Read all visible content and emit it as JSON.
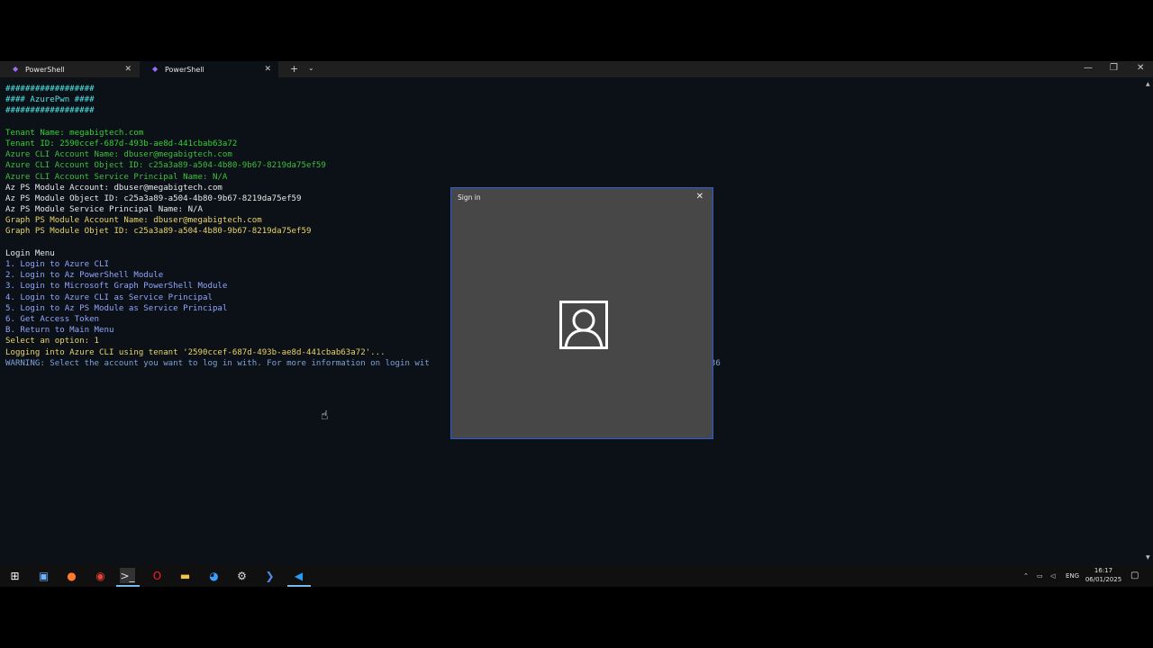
{
  "window": {
    "tabs": [
      {
        "label": "PowerShell"
      },
      {
        "label": "PowerShell"
      }
    ]
  },
  "terminal": {
    "lines": [
      {
        "text": "##################",
        "color": "cyan"
      },
      {
        "text": "#### AzurePwn ####",
        "color": "cyan"
      },
      {
        "text": "##################",
        "color": "cyan"
      },
      {
        "text": "",
        "color": "white"
      },
      {
        "text": "Tenant Name: megabigtech.com",
        "color": "green"
      },
      {
        "text": "Tenant ID: 2590ccef-687d-493b-ae8d-441cbab63a72",
        "color": "green"
      },
      {
        "text": "Azure CLI Account Name: dbuser@megabigtech.com",
        "color": "green2"
      },
      {
        "text": "Azure CLI Account Object ID: c25a3a89-a504-4b80-9b67-8219da75ef59",
        "color": "green2"
      },
      {
        "text": "Azure CLI Account Service Principal Name: N/A",
        "color": "green2"
      },
      {
        "text": "Az PS Module Account: dbuser@megabigtech.com",
        "color": "white"
      },
      {
        "text": "Az PS Module Object ID: c25a3a89-a504-4b80-9b67-8219da75ef59",
        "color": "white"
      },
      {
        "text": "Az PS Module Service Principal Name: N/A",
        "color": "white"
      },
      {
        "text": "Graph PS Module Account Name: dbuser@megabigtech.com",
        "color": "yellow"
      },
      {
        "text": "Graph PS Module Objet ID: c25a3a89-a504-4b80-9b67-8219da75ef59",
        "color": "yellow"
      },
      {
        "text": "",
        "color": "white"
      },
      {
        "text": "Login Menu",
        "color": "white"
      },
      {
        "text": "1. Login to Azure CLI",
        "color": "blue"
      },
      {
        "text": "2. Login to Az PowerShell Module",
        "color": "blue"
      },
      {
        "text": "3. Login to Microsoft Graph PowerShell Module",
        "color": "blue"
      },
      {
        "text": "4. Login to Azure CLI as Service Principal",
        "color": "blue"
      },
      {
        "text": "5. Login to Az PS Module as Service Principal",
        "color": "blue"
      },
      {
        "text": "6. Get Access Token",
        "color": "blue"
      },
      {
        "text": "B. Return to Main Menu",
        "color": "blue"
      },
      {
        "text": "Select an option: 1",
        "color": "yellow"
      },
      {
        "text": "Logging into Azure CLI using tenant '2590ccef-687d-493b-ae8d-441cbab63a72'...",
        "color": "yellow"
      },
      {
        "text": "WARNING: Select the account you want to log in with. For more information on login wit                                             .inkid=2271136",
        "color": "lblue"
      }
    ]
  },
  "dialog": {
    "title": "Sign in"
  },
  "taskbar": {
    "language": "ENG",
    "time": "16:17",
    "date": "06/01/2025"
  }
}
